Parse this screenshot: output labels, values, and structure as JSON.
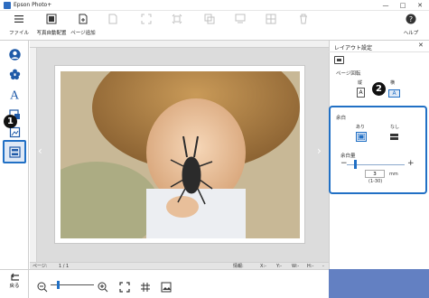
{
  "window": {
    "title": "Epson Photo+",
    "minimize": "—",
    "maximize": "□",
    "close": "✕"
  },
  "toolbar": {
    "file": "ファイル",
    "auto_layout": "写真自動配置",
    "add_page": "ページ追加",
    "help": "ヘルプ"
  },
  "panel": {
    "title": "レイアウト設定",
    "close": "✕",
    "orientation_label": "ページ回転",
    "portrait_label": "縦",
    "landscape_label": "横",
    "portrait_glyph": "A",
    "landscape_glyph": "A",
    "margin_label": "余白",
    "margin_on_label": "あり",
    "margin_off_label": "なし",
    "margin_amount_label": "余白量",
    "minus": "−",
    "plus": "+",
    "margin_value": "3",
    "unit": "mm",
    "range": "(1-30)"
  },
  "status": {
    "page_label": "ページ:",
    "page_value": "1 / 1",
    "info_label": "情報:",
    "x_label": "X:-",
    "y_label": "Y:-",
    "w_label": "W:-",
    "h_label": "H:-",
    "dash": "-"
  },
  "bottom": {
    "back_label": "戻る"
  },
  "badges": {
    "one": "1",
    "two": "2"
  },
  "nav": {
    "prev": "‹",
    "next": "›"
  },
  "accent": "#2170c5",
  "selection_margin_on": true,
  "selection_orientation": "landscape",
  "margin_level": 3
}
